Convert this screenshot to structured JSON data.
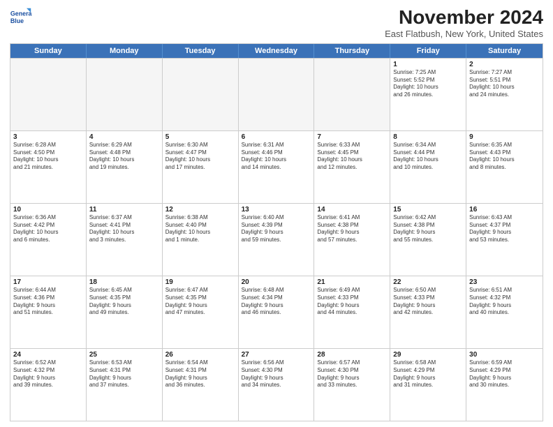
{
  "logo": {
    "line1": "General",
    "line2": "Blue"
  },
  "title": "November 2024",
  "subtitle": "East Flatbush, New York, United States",
  "days": [
    "Sunday",
    "Monday",
    "Tuesday",
    "Wednesday",
    "Thursday",
    "Friday",
    "Saturday"
  ],
  "rows": [
    [
      {
        "day": "",
        "info": "",
        "empty": true
      },
      {
        "day": "",
        "info": "",
        "empty": true
      },
      {
        "day": "",
        "info": "",
        "empty": true
      },
      {
        "day": "",
        "info": "",
        "empty": true
      },
      {
        "day": "",
        "info": "",
        "empty": true
      },
      {
        "day": "1",
        "info": "Sunrise: 7:25 AM\nSunset: 5:52 PM\nDaylight: 10 hours\nand 26 minutes.",
        "empty": false
      },
      {
        "day": "2",
        "info": "Sunrise: 7:27 AM\nSunset: 5:51 PM\nDaylight: 10 hours\nand 24 minutes.",
        "empty": false
      }
    ],
    [
      {
        "day": "3",
        "info": "Sunrise: 6:28 AM\nSunset: 4:50 PM\nDaylight: 10 hours\nand 21 minutes.",
        "empty": false
      },
      {
        "day": "4",
        "info": "Sunrise: 6:29 AM\nSunset: 4:48 PM\nDaylight: 10 hours\nand 19 minutes.",
        "empty": false
      },
      {
        "day": "5",
        "info": "Sunrise: 6:30 AM\nSunset: 4:47 PM\nDaylight: 10 hours\nand 17 minutes.",
        "empty": false
      },
      {
        "day": "6",
        "info": "Sunrise: 6:31 AM\nSunset: 4:46 PM\nDaylight: 10 hours\nand 14 minutes.",
        "empty": false
      },
      {
        "day": "7",
        "info": "Sunrise: 6:33 AM\nSunset: 4:45 PM\nDaylight: 10 hours\nand 12 minutes.",
        "empty": false
      },
      {
        "day": "8",
        "info": "Sunrise: 6:34 AM\nSunset: 4:44 PM\nDaylight: 10 hours\nand 10 minutes.",
        "empty": false
      },
      {
        "day": "9",
        "info": "Sunrise: 6:35 AM\nSunset: 4:43 PM\nDaylight: 10 hours\nand 8 minutes.",
        "empty": false
      }
    ],
    [
      {
        "day": "10",
        "info": "Sunrise: 6:36 AM\nSunset: 4:42 PM\nDaylight: 10 hours\nand 6 minutes.",
        "empty": false
      },
      {
        "day": "11",
        "info": "Sunrise: 6:37 AM\nSunset: 4:41 PM\nDaylight: 10 hours\nand 3 minutes.",
        "empty": false
      },
      {
        "day": "12",
        "info": "Sunrise: 6:38 AM\nSunset: 4:40 PM\nDaylight: 10 hours\nand 1 minute.",
        "empty": false
      },
      {
        "day": "13",
        "info": "Sunrise: 6:40 AM\nSunset: 4:39 PM\nDaylight: 9 hours\nand 59 minutes.",
        "empty": false
      },
      {
        "day": "14",
        "info": "Sunrise: 6:41 AM\nSunset: 4:38 PM\nDaylight: 9 hours\nand 57 minutes.",
        "empty": false
      },
      {
        "day": "15",
        "info": "Sunrise: 6:42 AM\nSunset: 4:38 PM\nDaylight: 9 hours\nand 55 minutes.",
        "empty": false
      },
      {
        "day": "16",
        "info": "Sunrise: 6:43 AM\nSunset: 4:37 PM\nDaylight: 9 hours\nand 53 minutes.",
        "empty": false
      }
    ],
    [
      {
        "day": "17",
        "info": "Sunrise: 6:44 AM\nSunset: 4:36 PM\nDaylight: 9 hours\nand 51 minutes.",
        "empty": false
      },
      {
        "day": "18",
        "info": "Sunrise: 6:45 AM\nSunset: 4:35 PM\nDaylight: 9 hours\nand 49 minutes.",
        "empty": false
      },
      {
        "day": "19",
        "info": "Sunrise: 6:47 AM\nSunset: 4:35 PM\nDaylight: 9 hours\nand 47 minutes.",
        "empty": false
      },
      {
        "day": "20",
        "info": "Sunrise: 6:48 AM\nSunset: 4:34 PM\nDaylight: 9 hours\nand 46 minutes.",
        "empty": false
      },
      {
        "day": "21",
        "info": "Sunrise: 6:49 AM\nSunset: 4:33 PM\nDaylight: 9 hours\nand 44 minutes.",
        "empty": false
      },
      {
        "day": "22",
        "info": "Sunrise: 6:50 AM\nSunset: 4:33 PM\nDaylight: 9 hours\nand 42 minutes.",
        "empty": false
      },
      {
        "day": "23",
        "info": "Sunrise: 6:51 AM\nSunset: 4:32 PM\nDaylight: 9 hours\nand 40 minutes.",
        "empty": false
      }
    ],
    [
      {
        "day": "24",
        "info": "Sunrise: 6:52 AM\nSunset: 4:32 PM\nDaylight: 9 hours\nand 39 minutes.",
        "empty": false
      },
      {
        "day": "25",
        "info": "Sunrise: 6:53 AM\nSunset: 4:31 PM\nDaylight: 9 hours\nand 37 minutes.",
        "empty": false
      },
      {
        "day": "26",
        "info": "Sunrise: 6:54 AM\nSunset: 4:31 PM\nDaylight: 9 hours\nand 36 minutes.",
        "empty": false
      },
      {
        "day": "27",
        "info": "Sunrise: 6:56 AM\nSunset: 4:30 PM\nDaylight: 9 hours\nand 34 minutes.",
        "empty": false
      },
      {
        "day": "28",
        "info": "Sunrise: 6:57 AM\nSunset: 4:30 PM\nDaylight: 9 hours\nand 33 minutes.",
        "empty": false
      },
      {
        "day": "29",
        "info": "Sunrise: 6:58 AM\nSunset: 4:29 PM\nDaylight: 9 hours\nand 31 minutes.",
        "empty": false
      },
      {
        "day": "30",
        "info": "Sunrise: 6:59 AM\nSunset: 4:29 PM\nDaylight: 9 hours\nand 30 minutes.",
        "empty": false
      }
    ]
  ]
}
